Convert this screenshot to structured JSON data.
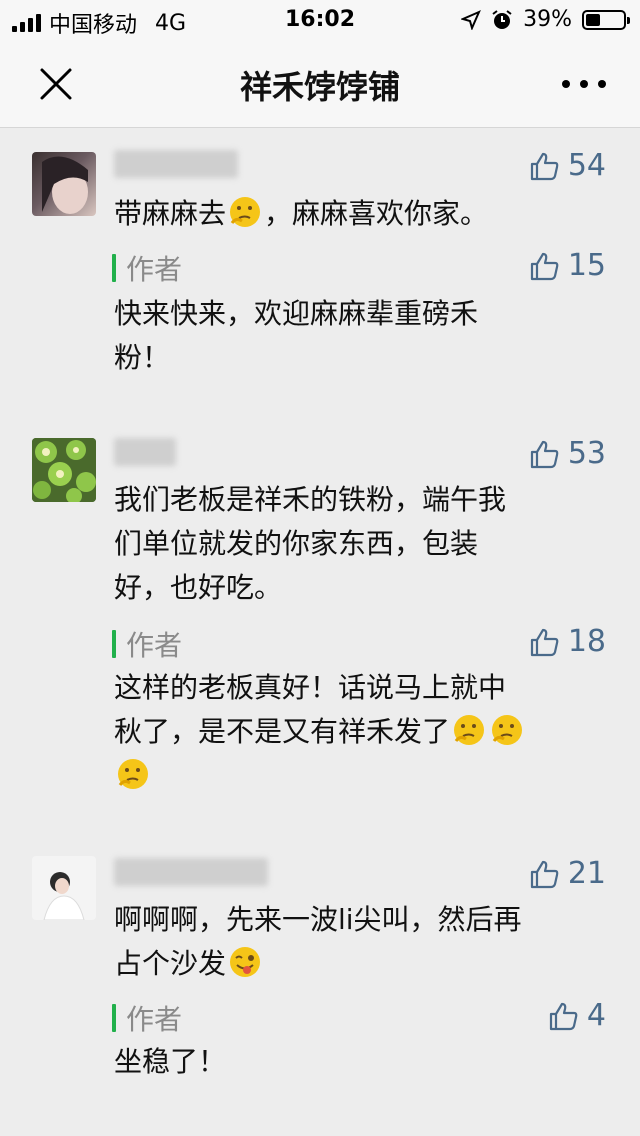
{
  "status_bar": {
    "carrier": "中国移动",
    "network": "4G",
    "time": "16:02",
    "battery": "39%"
  },
  "nav": {
    "title": "祥禾饽饽铺"
  },
  "comments": [
    {
      "likes": "54",
      "text_before": "带麻麻去",
      "text_after": "，麻麻喜欢你家。",
      "reply": {
        "author_label": "作者",
        "likes": "15",
        "text_line1": "快来快来，欢迎麻麻辈重磅禾",
        "text_line2": "粉！"
      }
    },
    {
      "likes": "53",
      "text_line1": "我们老板是祥禾的铁粉，端午我",
      "text_line2": "们单位就发的你家东西，包装",
      "text_line3": "好，也好吃。",
      "reply": {
        "author_label": "作者",
        "likes": "18",
        "text_line1": "这样的老板真好！话说马上就中",
        "text_line2": "秋了，是不是又有祥禾发了"
      }
    },
    {
      "likes": "21",
      "text_line1": "啊啊啊，先来一波li尖叫，然后再",
      "text_line2": "占个沙发",
      "reply": {
        "author_label": "作者",
        "likes": "4",
        "text": "坐稳了！"
      }
    }
  ],
  "colors": {
    "accent_green": "#21b04b",
    "like_blue": "#4a6a8a",
    "background": "#ededed"
  },
  "icons": [
    "signal-icon",
    "location-icon",
    "alarm-icon",
    "battery-icon",
    "close-icon",
    "more-icon",
    "thumbs-up-icon",
    "thinking-emoji-icon",
    "wink-tongue-emoji-icon"
  ]
}
